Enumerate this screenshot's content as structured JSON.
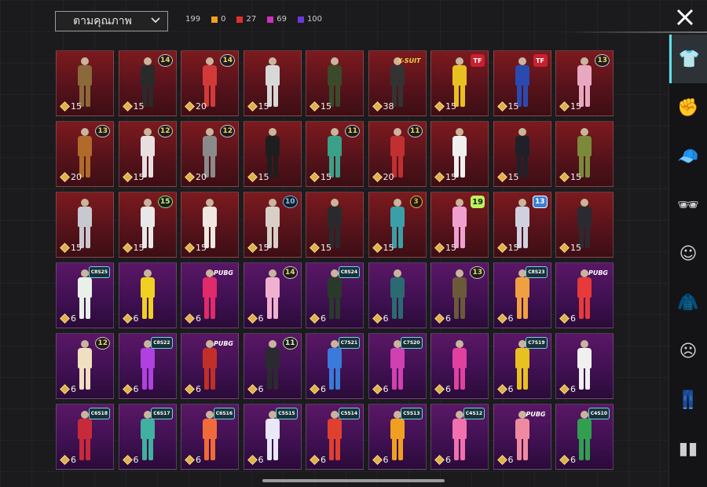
{
  "header": {
    "sort_label": "ตามคุณภาพ",
    "chevron_icon": "chevron-down-icon",
    "close_icon": "close-icon",
    "counts": [
      {
        "value": "199",
        "color": ""
      },
      {
        "value": "0",
        "color": "#f0a020"
      },
      {
        "value": "27",
        "color": "#e03030"
      },
      {
        "value": "69",
        "color": "#d030c0"
      },
      {
        "value": "100",
        "color": "#6a3ad8"
      }
    ]
  },
  "sidebar": {
    "categories": [
      {
        "icon": "outfit-icon",
        "glyph": "👕",
        "active": true
      },
      {
        "icon": "hand-icon",
        "glyph": "✊",
        "active": false
      },
      {
        "icon": "cap-icon",
        "glyph": "🧢",
        "active": false
      },
      {
        "icon": "sunglasses-icon",
        "glyph": "🕶",
        "active": false
      },
      {
        "icon": "mask-icon",
        "glyph": "☺",
        "active": false
      },
      {
        "icon": "jacket-icon",
        "glyph": "🧥",
        "active": false
      },
      {
        "icon": "face-icon",
        "glyph": "☹",
        "active": false
      },
      {
        "icon": "pants-icon",
        "glyph": "👖",
        "active": false
      },
      {
        "icon": "shoes-icon",
        "glyph": "▮▮",
        "active": false
      }
    ]
  },
  "items": [
    {
      "tier": "red",
      "price": "15",
      "badge": "",
      "badge_type": "",
      "outfit": "#8a6a3a"
    },
    {
      "tier": "red",
      "price": "15",
      "badge": "14",
      "badge_type": "circle",
      "outfit": "#2a2a2a"
    },
    {
      "tier": "red",
      "price": "20",
      "badge": "14",
      "badge_type": "circle",
      "outfit": "#d23a3a"
    },
    {
      "tier": "red",
      "price": "15",
      "badge": "",
      "badge_type": "",
      "outfit": "#d8d8d8"
    },
    {
      "tier": "red",
      "price": "15",
      "badge": "",
      "badge_type": "",
      "outfit": "#3a4a2a"
    },
    {
      "tier": "red",
      "price": "38",
      "badge": "X-SUIT",
      "badge_type": "xsuit",
      "outfit": "#333"
    },
    {
      "tier": "red",
      "price": "15",
      "badge": "TF",
      "badge_type": "tf",
      "outfit": "#e8c020"
    },
    {
      "tier": "red",
      "price": "15",
      "badge": "TF",
      "badge_type": "tf",
      "outfit": "#2a4ab0"
    },
    {
      "tier": "red",
      "price": "15",
      "badge": "13",
      "badge_type": "circle",
      "outfit": "#e8a8c0"
    },
    {
      "tier": "red",
      "price": "20",
      "badge": "13",
      "badge_type": "circle",
      "outfit": "#b06a2a"
    },
    {
      "tier": "red",
      "price": "15",
      "badge": "12",
      "badge_type": "circle",
      "outfit": "#e8e0e0"
    },
    {
      "tier": "red",
      "price": "20",
      "badge": "12",
      "badge_type": "circle",
      "outfit": "#8a8a8a"
    },
    {
      "tier": "red",
      "price": "15",
      "badge": "",
      "badge_type": "",
      "outfit": "#1e1e1e"
    },
    {
      "tier": "red",
      "price": "15",
      "badge": "11",
      "badge_type": "circle",
      "outfit": "#3aa088"
    },
    {
      "tier": "red",
      "price": "20",
      "badge": "11",
      "badge_type": "circle",
      "outfit": "#c03030"
    },
    {
      "tier": "red",
      "price": "15",
      "badge": "",
      "badge_type": "",
      "outfit": "#f0f0f0"
    },
    {
      "tier": "red",
      "price": "15",
      "badge": "",
      "badge_type": "",
      "outfit": "#202028"
    },
    {
      "tier": "red",
      "price": "15",
      "badge": "",
      "badge_type": "",
      "outfit": "#7a8a3a"
    },
    {
      "tier": "red",
      "price": "15",
      "badge": "",
      "badge_type": "",
      "outfit": "#c8c8d0"
    },
    {
      "tier": "red",
      "price": "15",
      "badge": "15",
      "badge_type": "lvl15",
      "outfit": "#e8e8e8"
    },
    {
      "tier": "red",
      "price": "15",
      "badge": "",
      "badge_type": "",
      "outfit": "#f0e8e0"
    },
    {
      "tier": "red",
      "price": "15",
      "badge": "10",
      "badge_type": "lvl10",
      "outfit": "#d8d0c8"
    },
    {
      "tier": "red",
      "price": "15",
      "badge": "",
      "badge_type": "",
      "outfit": "#2a2a2e"
    },
    {
      "tier": "red",
      "price": "15",
      "badge": "3",
      "badge_type": "lvl3",
      "outfit": "#3aa0a8"
    },
    {
      "tier": "red",
      "price": "15",
      "badge": "19",
      "badge_type": "lvl19",
      "outfit": "#f0a0d0"
    },
    {
      "tier": "red",
      "price": "15",
      "badge": "13",
      "badge_type": "lvl13b",
      "outfit": "#d0d0e0"
    },
    {
      "tier": "red",
      "price": "15",
      "badge": "",
      "badge_type": "",
      "outfit": "#2a2a30"
    },
    {
      "tier": "purple",
      "price": "6",
      "badge": "C8S25",
      "badge_type": "hex",
      "outfit": "#e8f0e8"
    },
    {
      "tier": "purple",
      "price": "6",
      "badge": "",
      "badge_type": "",
      "outfit": "#f0d020"
    },
    {
      "tier": "purple",
      "price": "6",
      "badge": "PUBG",
      "badge_type": "pubg",
      "outfit": "#e02a6a"
    },
    {
      "tier": "purple",
      "price": "6",
      "badge": "14",
      "badge_type": "circle",
      "outfit": "#f0b0d0"
    },
    {
      "tier": "purple",
      "price": "6",
      "badge": "C8S24",
      "badge_type": "hex",
      "outfit": "#2a3a2a"
    },
    {
      "tier": "purple",
      "price": "6",
      "badge": "",
      "badge_type": "",
      "outfit": "#2a6a70"
    },
    {
      "tier": "purple",
      "price": "6",
      "badge": "13",
      "badge_type": "circle",
      "outfit": "#6a5a3a"
    },
    {
      "tier": "purple",
      "price": "6",
      "badge": "C8S23",
      "badge_type": "hex",
      "outfit": "#f0a040"
    },
    {
      "tier": "purple",
      "price": "6",
      "badge": "PUBG",
      "badge_type": "pubg",
      "outfit": "#e83a3a"
    },
    {
      "tier": "purple",
      "price": "6",
      "badge": "12",
      "badge_type": "circle",
      "outfit": "#f0e0c0"
    },
    {
      "tier": "purple",
      "price": "6",
      "badge": "C8S22",
      "badge_type": "hex",
      "outfit": "#b040e0"
    },
    {
      "tier": "purple",
      "price": "6",
      "badge": "PUBG",
      "badge_type": "pubg",
      "outfit": "#c03028"
    },
    {
      "tier": "purple",
      "price": "6",
      "badge": "11",
      "badge_type": "lvl11",
      "outfit": "#2a2a30"
    },
    {
      "tier": "purple",
      "price": "6",
      "badge": "C7S21",
      "badge_type": "hex",
      "outfit": "#3a7ad8"
    },
    {
      "tier": "purple",
      "price": "6",
      "badge": "C7S20",
      "badge_type": "hex",
      "outfit": "#d040b0"
    },
    {
      "tier": "purple",
      "price": "6",
      "badge": "",
      "badge_type": "",
      "outfit": "#e040a0"
    },
    {
      "tier": "purple",
      "price": "6",
      "badge": "C7S19",
      "badge_type": "hex",
      "outfit": "#e8c020"
    },
    {
      "tier": "purple",
      "price": "6",
      "badge": "",
      "badge_type": "",
      "outfit": "#f0f0f0"
    },
    {
      "tier": "purple",
      "price": "6",
      "badge": "C6S18",
      "badge_type": "hex",
      "outfit": "#c82a3a"
    },
    {
      "tier": "purple",
      "price": "6",
      "badge": "C6S17",
      "badge_type": "hex",
      "outfit": "#40b0a0"
    },
    {
      "tier": "purple",
      "price": "6",
      "badge": "C6S16",
      "badge_type": "hex",
      "outfit": "#f06a3a"
    },
    {
      "tier": "purple",
      "price": "6",
      "badge": "C5S15",
      "badge_type": "hex",
      "outfit": "#e8e8f8"
    },
    {
      "tier": "purple",
      "price": "6",
      "badge": "C5S14",
      "badge_type": "hex",
      "outfit": "#e04030"
    },
    {
      "tier": "purple",
      "price": "6",
      "badge": "C5S13",
      "badge_type": "hex",
      "outfit": "#f0a020"
    },
    {
      "tier": "purple",
      "price": "6",
      "badge": "C4S12",
      "badge_type": "hex",
      "outfit": "#f070b0"
    },
    {
      "tier": "purple",
      "price": "6",
      "badge": "PUBG",
      "badge_type": "pubg",
      "outfit": "#f08aa0"
    },
    {
      "tier": "purple",
      "price": "6",
      "badge": "C4S10",
      "badge_type": "hex",
      "outfit": "#30a050"
    }
  ]
}
